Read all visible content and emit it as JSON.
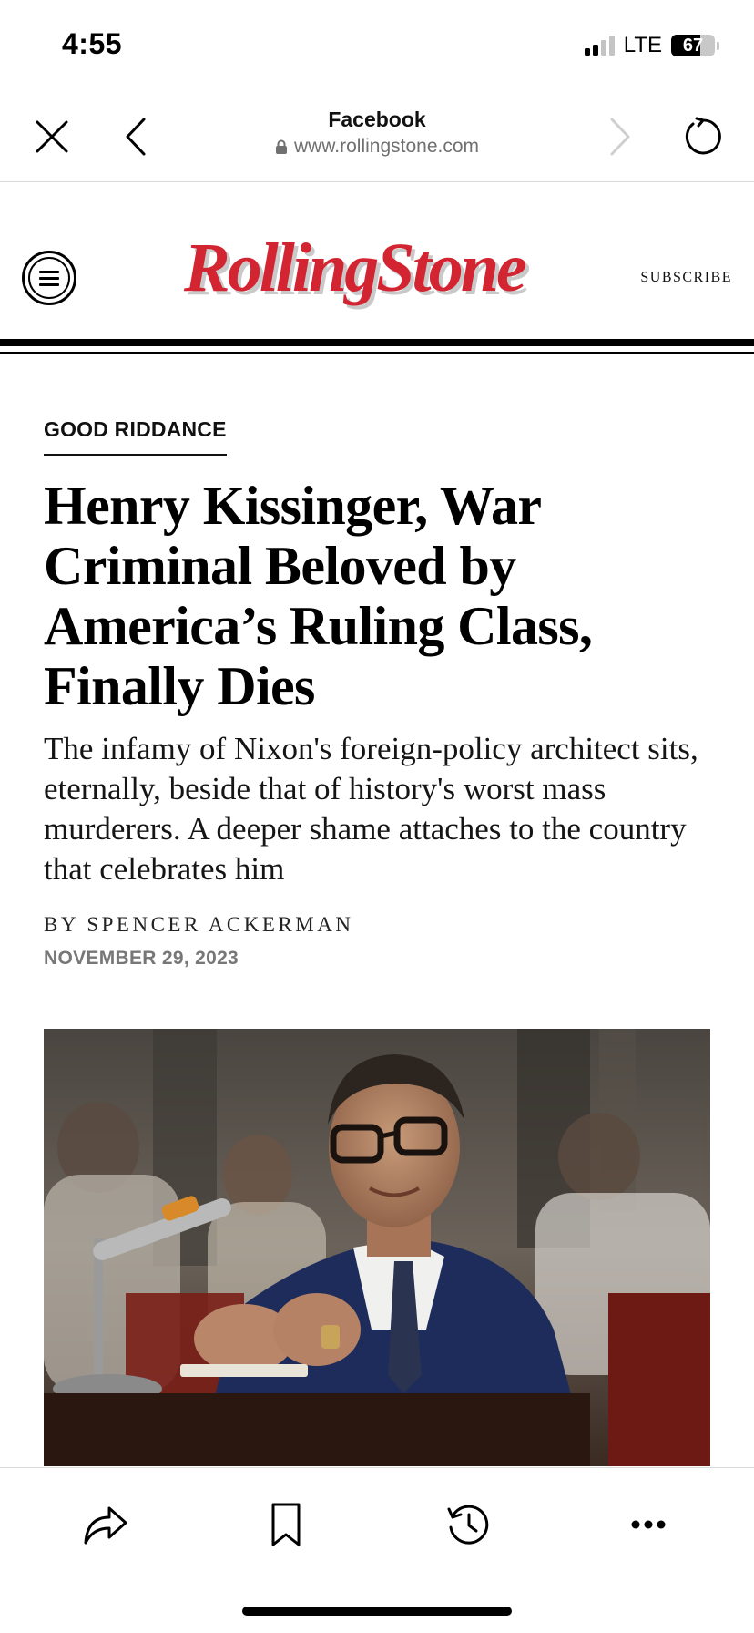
{
  "status_bar": {
    "time": "4:55",
    "network": "LTE",
    "battery_percent": "67",
    "battery_level": 0.67,
    "signal_bars_active": 2,
    "signal_bars_total": 4
  },
  "browser": {
    "title": "Facebook",
    "url": "www.rollingstone.com",
    "icons": {
      "close": "close-icon",
      "back": "chevron-left-icon",
      "forward": "chevron-right-icon",
      "reload": "reload-icon",
      "lock": "lock-icon"
    }
  },
  "site": {
    "logo_text": "RollingStone",
    "logo_color": "#d32531",
    "subscribe_label": "SUBSCRIBE",
    "menu_icon": "hamburger-menu-icon"
  },
  "article": {
    "kicker": "GOOD RIDDANCE",
    "headline": "Henry Kissinger, War Criminal Beloved by America’s Ruling Class, Finally Dies",
    "dek": "The infamy of Nixon's foreign-policy architect sits, eternally, beside that of history's worst mass murderers. A deeper shame attaches to the country that celebrates him",
    "byline": "BY SPENCER ACKERMAN",
    "date": "NOVEMBER 29, 2023"
  },
  "toolbar": {
    "icons": [
      "share-icon",
      "bookmark-icon",
      "history-icon",
      "more-icon"
    ]
  }
}
